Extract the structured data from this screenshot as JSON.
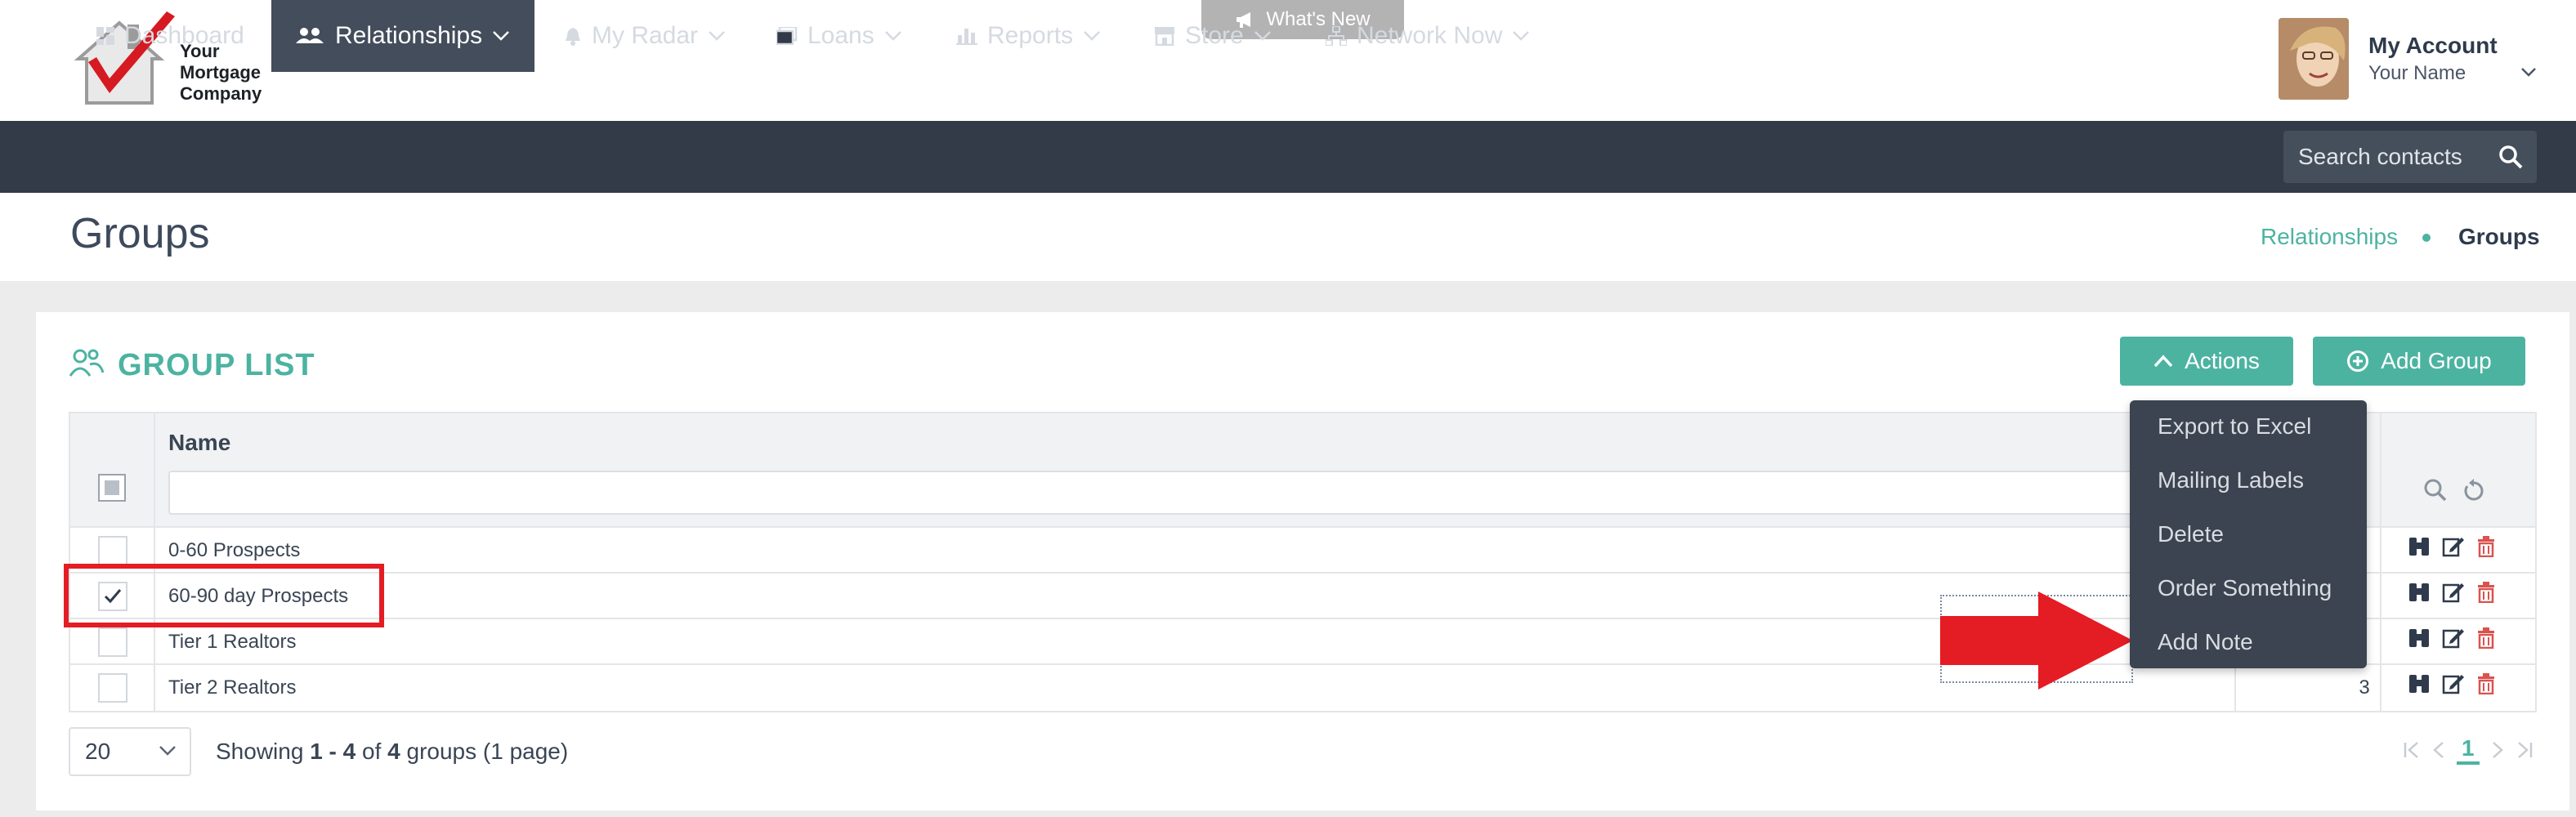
{
  "header": {
    "logo_line1": "Your",
    "logo_line2": "Mortgage",
    "logo_line3": "Company",
    "whats_new": "What's New",
    "account_title": "My Account",
    "account_name": "Your Name"
  },
  "nav": {
    "items": [
      {
        "label": "Dashboard",
        "icon": "dashboard-icon"
      },
      {
        "label": "Relationships",
        "icon": "users-icon",
        "active": true
      },
      {
        "label": "My Radar",
        "icon": "bell-icon"
      },
      {
        "label": "Loans",
        "icon": "loans-icon"
      },
      {
        "label": "Reports",
        "icon": "bar-chart-icon"
      },
      {
        "label": "Store",
        "icon": "store-icon"
      },
      {
        "label": "Network Now",
        "icon": "network-icon"
      }
    ],
    "search_placeholder": "Search contacts"
  },
  "page": {
    "title": "Groups",
    "breadcrumb": [
      "Relationships",
      "Groups"
    ]
  },
  "card": {
    "title": "GROUP LIST",
    "actions_label": "Actions",
    "add_group_label": "Add Group"
  },
  "table": {
    "name_header": "Name",
    "rows": [
      {
        "name": "0-60 Prospects",
        "checked": false,
        "count": ""
      },
      {
        "name": "60-90 day Prospects",
        "checked": true,
        "count": ""
      },
      {
        "name": "Tier 1 Realtors",
        "checked": false,
        "count": ""
      },
      {
        "name": "Tier 2 Realtors",
        "checked": false,
        "count": "3"
      }
    ]
  },
  "footer": {
    "page_size": "20",
    "showing_prefix": "Showing",
    "range": "1 - 4",
    "of": "of",
    "total": "4",
    "suffix": "groups (1 page)",
    "current_page": "1"
  },
  "actions_menu": {
    "items": [
      "Export to Excel",
      "Mailing Labels",
      "Delete",
      "Order Something",
      "Add Note"
    ]
  },
  "colors": {
    "accent": "#4cb3a1",
    "navbar": "#323b47",
    "annotation": "#e41c23",
    "delete_icon": "#d9534f"
  }
}
